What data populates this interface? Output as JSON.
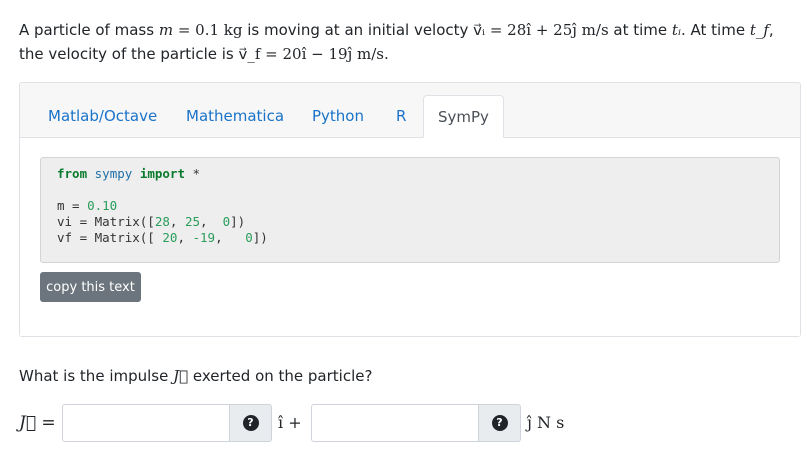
{
  "problem": {
    "text_a": "A particle of mass ",
    "mass_var": "m",
    "mass_eq": " = 0.1 kg",
    "text_b": " is moving at an initial velocty ",
    "vi_expr": "v⃗ᵢ = 28î + 25ĵ m/s",
    "text_c": " at time ",
    "ti": "tᵢ",
    "text_d": ". At time ",
    "tf": "t_f",
    "text_e": ", the velocity of the particle is ",
    "vf_expr": "v⃗_f = 20î − 19ĵ m/s",
    "text_f": "."
  },
  "tabs": [
    "Matlab/Octave",
    "Mathematica",
    "Python",
    "R",
    "SymPy"
  ],
  "active_tab": "SymPy",
  "code": {
    "line1_kw1": "from",
    "line1_mod": "sympy",
    "line1_kw2": "import",
    "line1_star": "*",
    "m_prefix": "m = ",
    "m_val": "0.10",
    "vi_prefix": "vi = Matrix([",
    "vi_vals": [
      "28",
      "25",
      "0"
    ],
    "vf_prefix": "vf = Matrix([",
    "vf_vals": [
      "20",
      "-19",
      "0"
    ]
  },
  "copy_label": "copy this text",
  "question": {
    "text_a": "What is the impulse ",
    "var": "J⃗",
    "text_b": " exerted on the particle?"
  },
  "answer": {
    "lhs": "J⃗ =",
    "help_glyph": "?",
    "i_unit": "î +",
    "j_unit": "ĵ N s",
    "field1_value": "",
    "field2_value": ""
  }
}
